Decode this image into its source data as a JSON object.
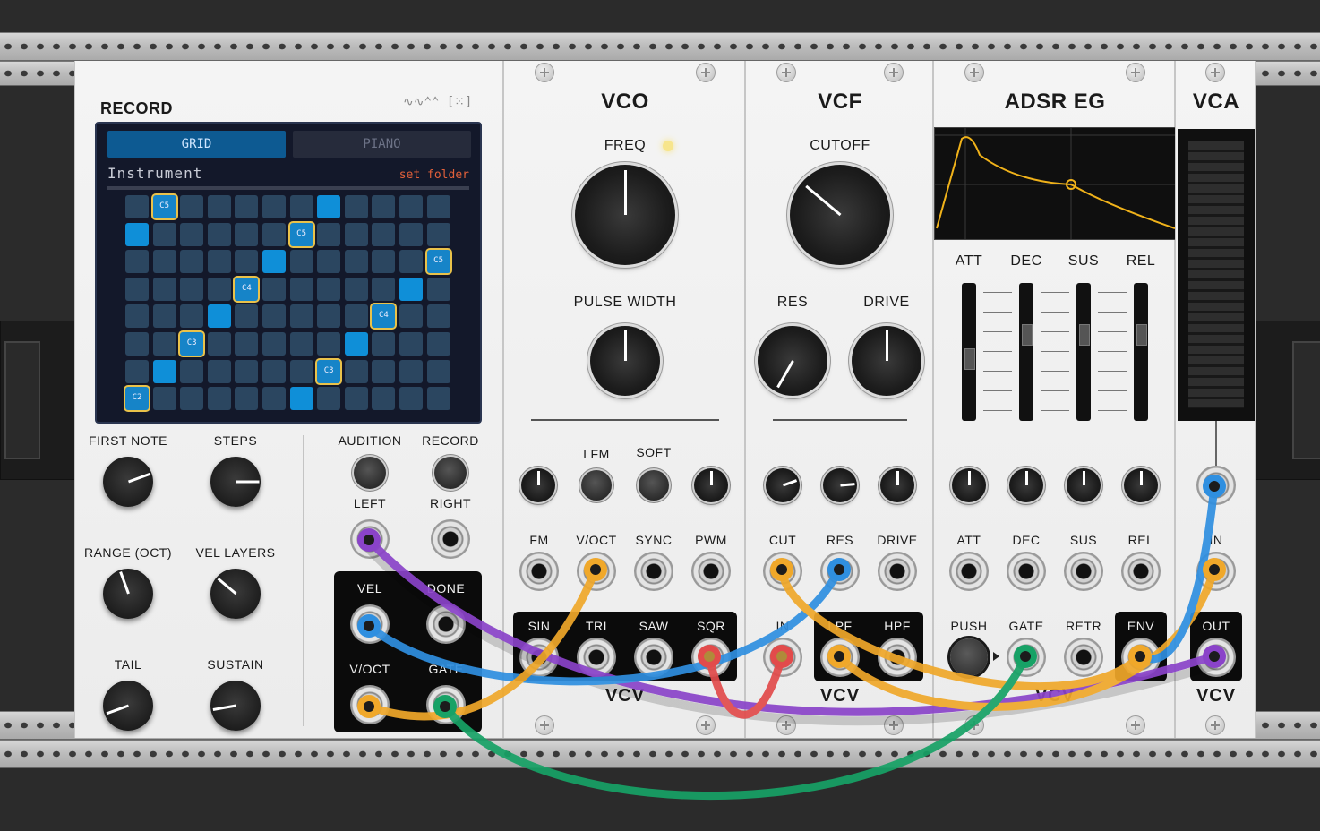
{
  "rack": {
    "logo": "VCV"
  },
  "record": {
    "title": "RECORD",
    "tabs": [
      {
        "label": "GRID",
        "active": true
      },
      {
        "label": "PIANO",
        "active": false
      }
    ],
    "instrument_label": "Instrument",
    "set_folder_label": "set folder",
    "knobs": {
      "first_note": "FIRST NOTE",
      "steps": "STEPS",
      "range": "RANGE (OCT)",
      "vel_layers": "VEL LAYERS",
      "tail": "TAIL",
      "sustain": "SUSTAIN"
    },
    "buttons": {
      "audition": "AUDITION",
      "record": "RECORD"
    },
    "jacks": {
      "left": "LEFT",
      "right": "RIGHT",
      "vel": "VEL",
      "done": "DONE",
      "voct": "V/OCT",
      "gate": "GATE"
    },
    "grid_notes": [
      "C5",
      "C5",
      "C5",
      "C4",
      "C4",
      "C3",
      "C3",
      "C2"
    ]
  },
  "vco": {
    "title": "VCO",
    "freq": "FREQ",
    "pulse_width": "PULSE WIDTH",
    "lfm": "LFM",
    "soft": "SOFT",
    "inputs": [
      "FM",
      "V/OCT",
      "SYNC",
      "PWM"
    ],
    "outputs": [
      "SIN",
      "TRI",
      "SAW",
      "SQR"
    ]
  },
  "vcf": {
    "title": "VCF",
    "cutoff": "CUTOFF",
    "res": "RES",
    "drive": "DRIVE",
    "inputs": [
      "CUT",
      "RES",
      "DRIVE"
    ],
    "in": "IN",
    "outputs": [
      "LPF",
      "HPF"
    ]
  },
  "adsr": {
    "title": "ADSR EG",
    "sliders": [
      "ATT",
      "DEC",
      "SUS",
      "REL"
    ],
    "inputs": [
      "ATT",
      "DEC",
      "SUS",
      "REL"
    ],
    "push": "PUSH",
    "gate": "GATE",
    "retr": "RETR",
    "env": "ENV"
  },
  "vca": {
    "title": "VCA",
    "in": "IN",
    "out": "OUT"
  },
  "colors": {
    "purple": "#8a43c9",
    "blue": "#2f8fe0",
    "orange": "#f0a82a",
    "green": "#17a266",
    "red": "#e24b4b",
    "screen": "#13182a",
    "accent": "#0f8fd8"
  }
}
